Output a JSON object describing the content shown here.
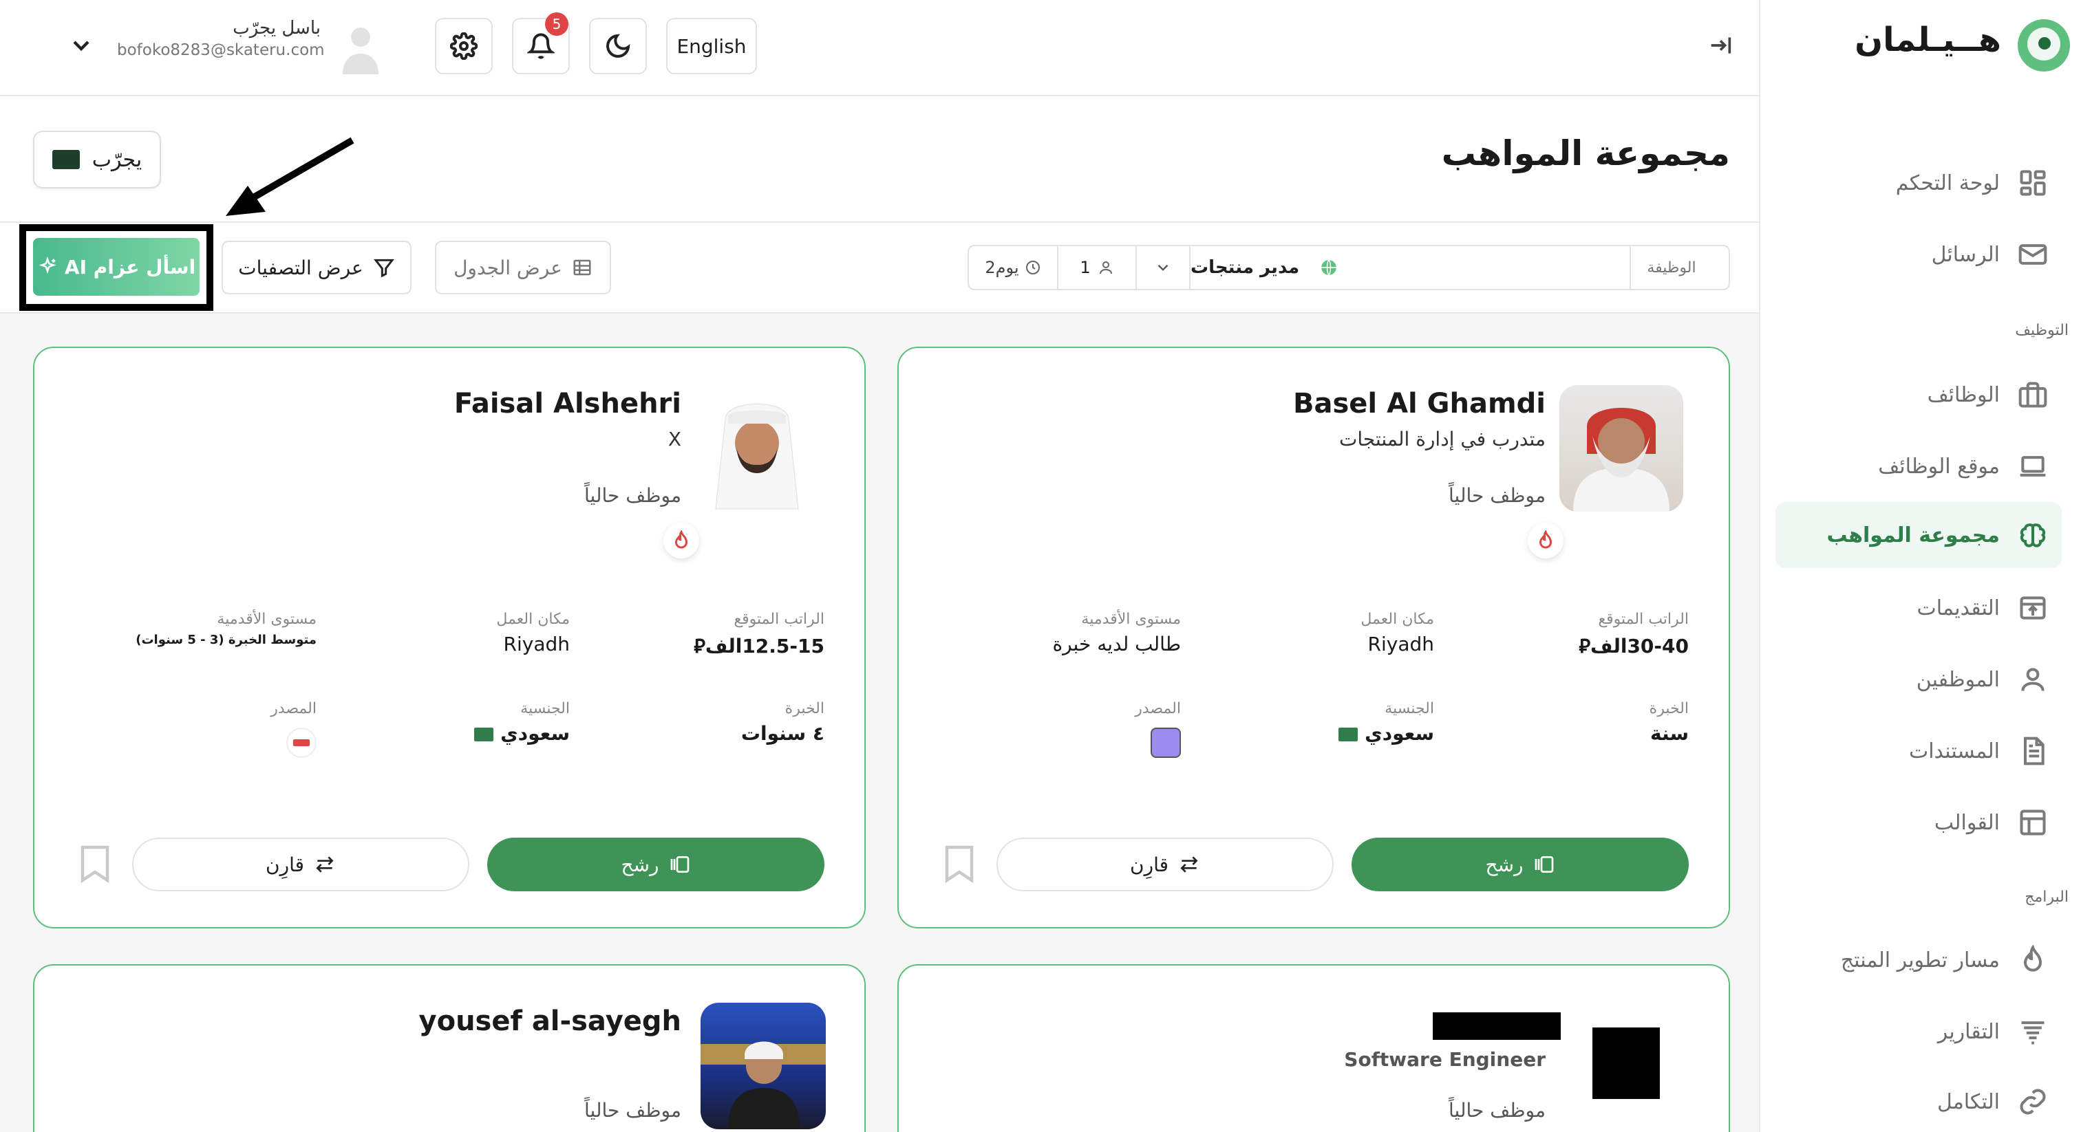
{
  "brand": {
    "name": "هــيـلمان"
  },
  "sidebar": {
    "items": [
      {
        "label": "لوحة التحكم",
        "icon": "dashboard-icon"
      },
      {
        "label": "الرسائل",
        "icon": "mail-icon"
      },
      {
        "label": "الوظائف",
        "icon": "briefcase-icon"
      },
      {
        "label": "موقع الوظائف",
        "icon": "laptop-icon"
      },
      {
        "label": "مجموعة المواهب",
        "icon": "brain-icon",
        "active": true
      },
      {
        "label": "التقديمات",
        "icon": "inbox-upload-icon"
      },
      {
        "label": "الموظفين",
        "icon": "user-icon"
      },
      {
        "label": "المستندات",
        "icon": "document-icon"
      },
      {
        "label": "القوالب",
        "icon": "layout-icon"
      },
      {
        "label": "مسار تطوير المنتج",
        "icon": "flame-icon"
      },
      {
        "label": "التقارير",
        "icon": "report-lines-icon"
      },
      {
        "label": "التكامل",
        "icon": "link-icon"
      }
    ],
    "sections": {
      "hiring": "التوظيف",
      "programs": "البرامج"
    }
  },
  "header": {
    "user_name": "باسل يجرّب",
    "user_email": "bofoko8283@skateru.com",
    "notifications_count": "5",
    "language_button": "English"
  },
  "page": {
    "title": "مجموعة المواهب",
    "try_button": "يجرّب"
  },
  "filters": {
    "ai_button": "اسأل عزام AI",
    "show_filters": "عرض التصفيات",
    "table_view": "عرض الجدول",
    "job_label": "الوظيفة",
    "job_value": "مدير منتجات",
    "applicants_count": "1",
    "days": "2يوم"
  },
  "labels": {
    "expected_salary": "الراتب المتوقع",
    "work_location": "مكان العمل",
    "seniority": "مستوى الأقدمية",
    "experience": "الخبرة",
    "nationality": "الجنسية",
    "source": "المصدر",
    "apply": "رشح",
    "compare": "قارِن"
  },
  "candidates": [
    {
      "name": "Basel Al Ghamdi",
      "title": "متدرب في إدارة المنتجات",
      "status": "موظف حالياً",
      "salary": "30-40الف",
      "location": "Riyadh",
      "seniority": "طالب لديه خبرة",
      "experience": "سنة",
      "nationality": "سعودي"
    },
    {
      "name": "Faisal Alshehri",
      "title": "X",
      "status": "موظف حالياً",
      "salary": "12.5-15الف",
      "location": "Riyadh",
      "seniority": "متوسط الخبرة (3 - 5 سنوات)",
      "experience": "٤ سنوات",
      "nationality": "سعودي"
    },
    {
      "name": "",
      "title": "Software Engineer",
      "status": "موظف حالياً"
    },
    {
      "name": "yousef al-sayegh",
      "title": "",
      "status": "موظف حالياً"
    }
  ]
}
